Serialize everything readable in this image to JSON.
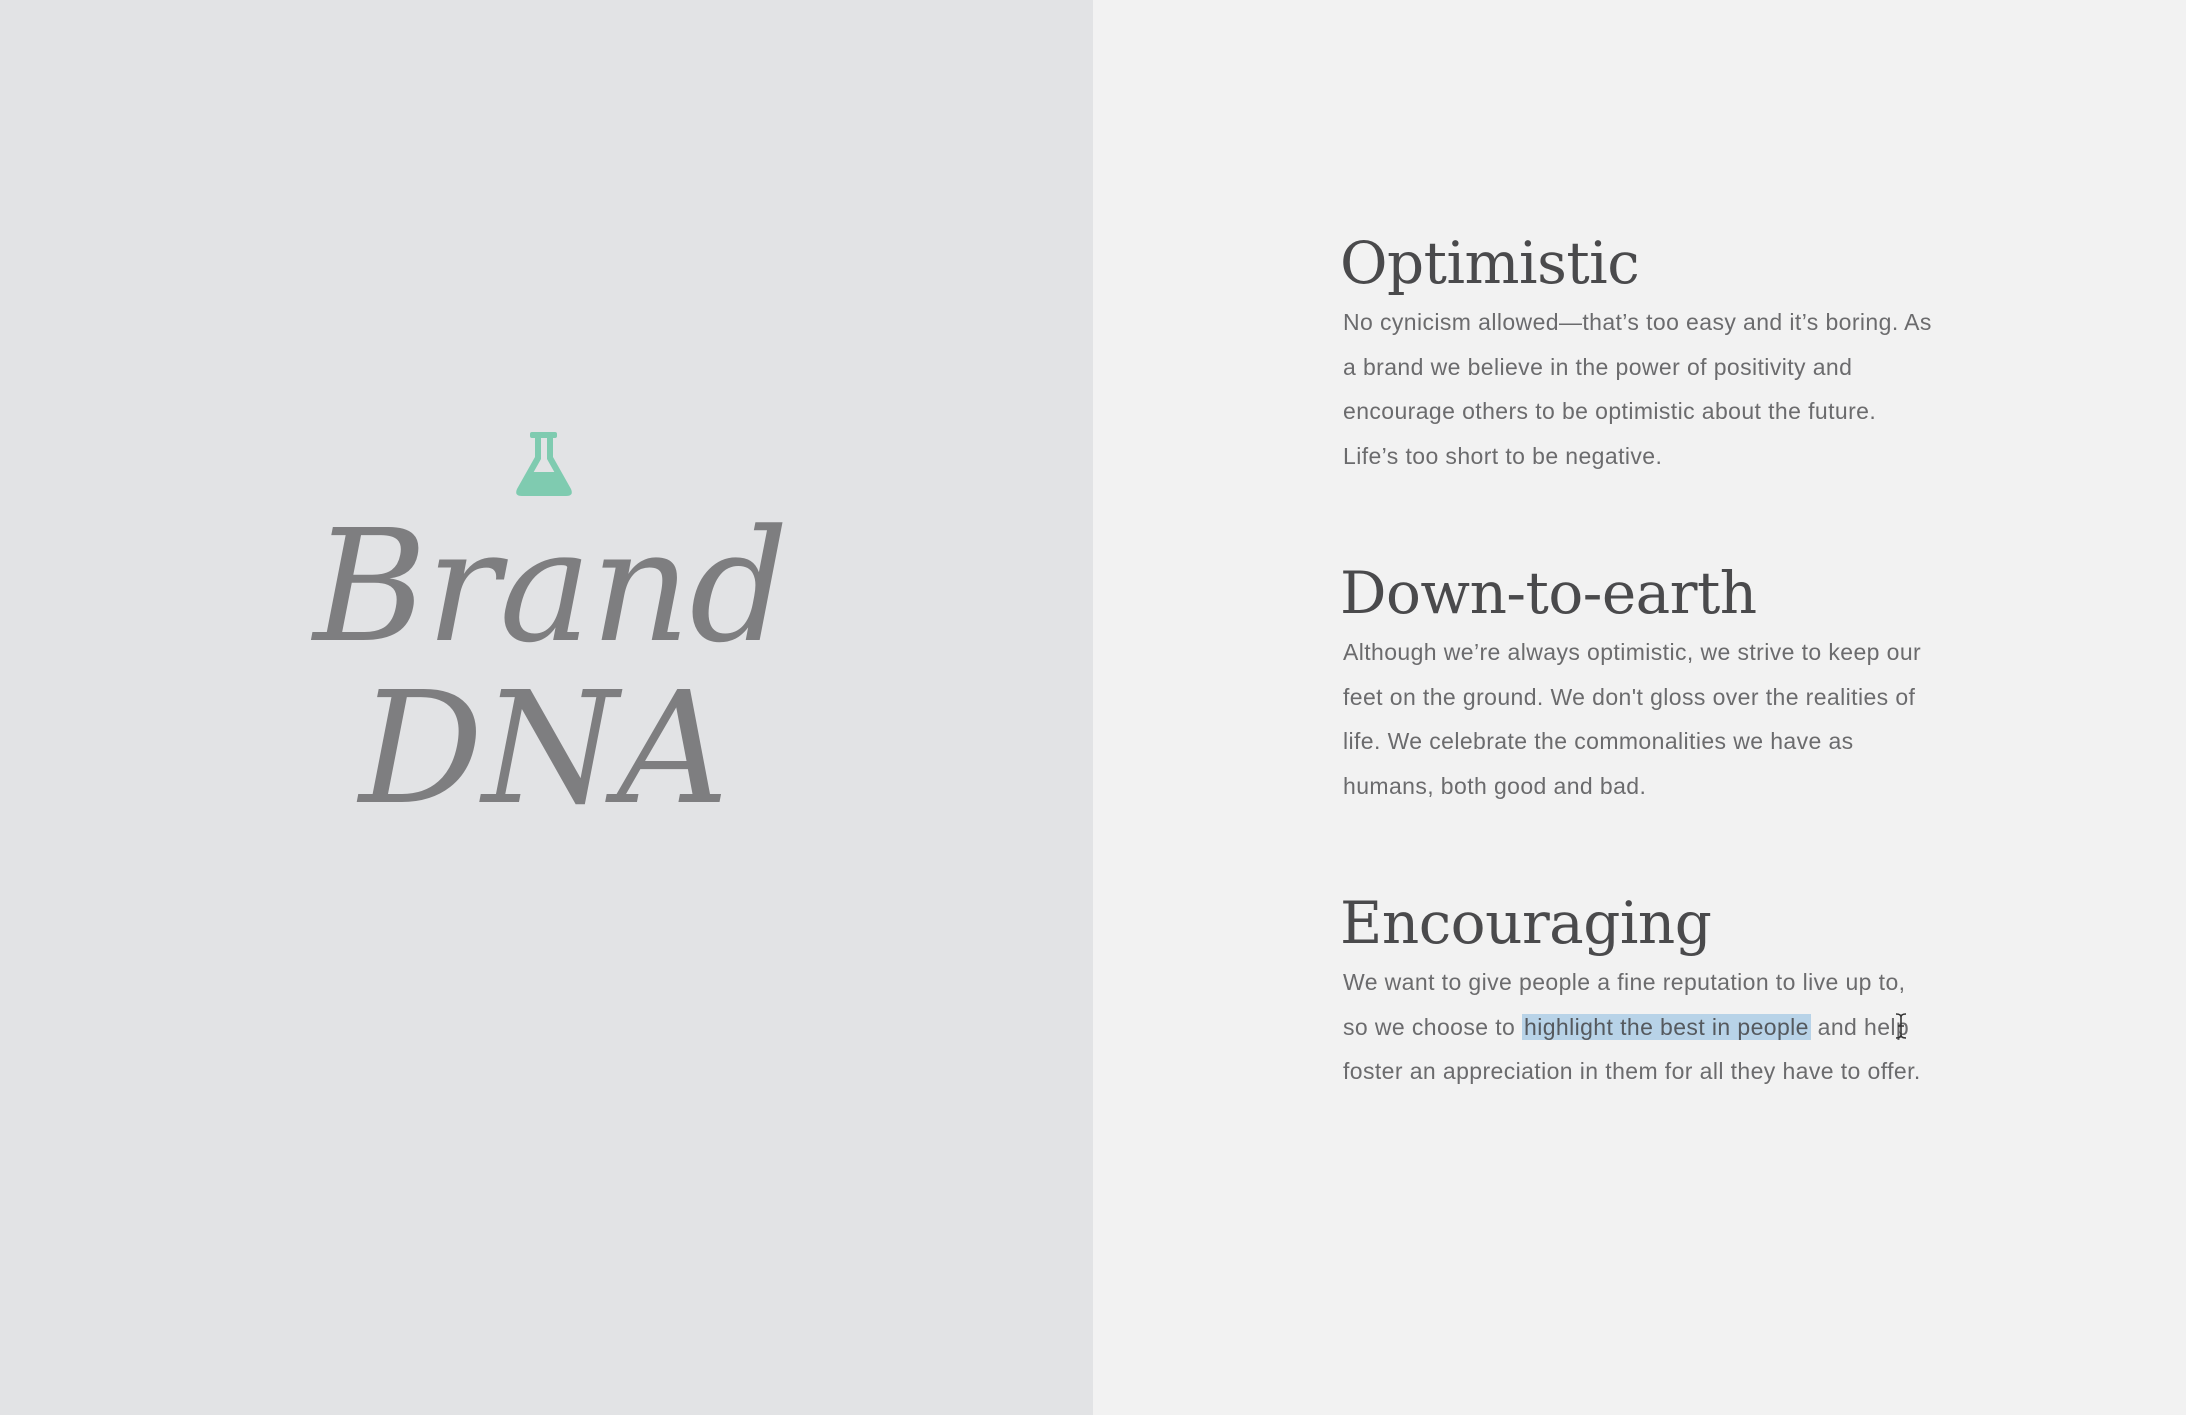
{
  "left_panel": {
    "icon": "flask-icon",
    "title_line_1": "Brand",
    "title_line_2": "DNA"
  },
  "sections": [
    {
      "heading": "Optimistic",
      "body": "No cynicism allowed—that’s too easy and it’s boring. As a brand we believe in the power of positivity and encourage others to be optimistic about the future. Life’s too short to be negative."
    },
    {
      "heading": "Down-to-earth",
      "body": "Although we’re always optimistic, we strive to keep our feet on the ground. We don't gloss over the realities of life. We celebrate the commonalities we have as humans, both good and bad."
    },
    {
      "heading": "Encouraging",
      "body_before": "We want to give people a fine reputation to live up to, so we choose to ",
      "body_highlight": "highlight the best in people",
      "body_after": " and help foster an appreciation in them for all they have to offer."
    }
  ],
  "colors": {
    "left_background": "#e2e3e5",
    "right_background": "#f2f2f2",
    "accent": "#7fcbb0",
    "selection": "#b8d3e8"
  },
  "cursor": "text-cursor-icon"
}
